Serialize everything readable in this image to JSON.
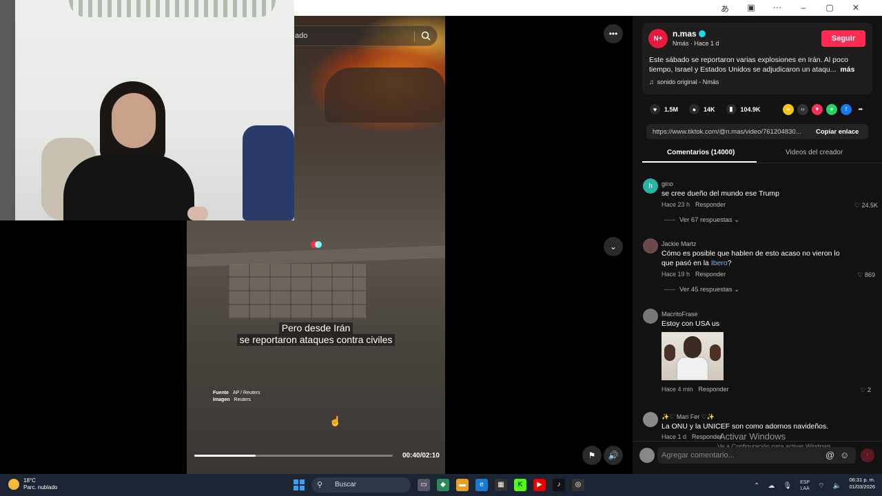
{
  "video": {
    "search_placeholder": "ado",
    "caption_line1": "Pero desde Irán",
    "caption_line2": "se reportaron ataques contra civiles",
    "source_label": "Fuente",
    "source_value": "AP / Reuters",
    "image_label": "Imagen",
    "image_value": "Reuters",
    "timecode": "00:40/02:10",
    "progress_fraction": 0.31
  },
  "post": {
    "avatar_text": "N+",
    "account_name": "n.mas",
    "account_sub": "Nmás · Hace 1 d",
    "follow_label": "Seguir",
    "description": "Este sábado se reportaron varias explosiones en Irán. Al poco tiempo, Israel y Estados Unidos se adjudicaron un ataqu...",
    "more_label": "más",
    "sound": "sonido original - Nmás",
    "likes": "1.5M",
    "comments": "14K",
    "saves": "104.9K",
    "link_url": "https://www.tiktok.com/@n.mas/video/761204830...",
    "copy_link_label": "Copiar enlace"
  },
  "tabs": {
    "comments": "Comentarios (14000)",
    "creator_videos": "Videos del creador"
  },
  "comments": [
    {
      "avatar": "h",
      "user": "gino",
      "text": "se cree dueño del mundo ese Trump",
      "time": "Hace 23 h",
      "reply": "Responder",
      "likes": "24.5K",
      "replies": "Ver 67 respuestas"
    },
    {
      "user": "Jackie Martz",
      "text_pre": "Cómo es posible que hablen de esto acaso no vieron lo que pasó en la ",
      "text_link": "Ibero",
      "text_post": "?",
      "time": "Hace 19 h",
      "reply": "Responder",
      "likes": "869",
      "replies": "Ver 45 respuestas"
    },
    {
      "user": "MacritoFrase",
      "text": "Estoy con USA us",
      "time": "Hace 4 min",
      "reply": "Responder",
      "likes": "2"
    },
    {
      "user": "✨♡ Mari Fer ♡✨",
      "text": "La ONU y la UNICEF son como adornos navideños.",
      "time": "Hace 1 d",
      "reply": "Responder"
    }
  ],
  "comment_box": {
    "placeholder": "Agregar comentario..."
  },
  "watermark": {
    "line1": "Activar Windows",
    "line2": "Ve a Configuración para activar Windows."
  },
  "taskbar": {
    "temp": "18°C",
    "weather": "Parc. nublado",
    "search": "Buscar",
    "lang1": "ESP",
    "lang2": "LAA",
    "time": "06:31 p. m.",
    "date": "01/03/2026"
  },
  "colors": {
    "accent": "#fe2c55",
    "panel": "#121212",
    "link": "#7ab4ff"
  }
}
